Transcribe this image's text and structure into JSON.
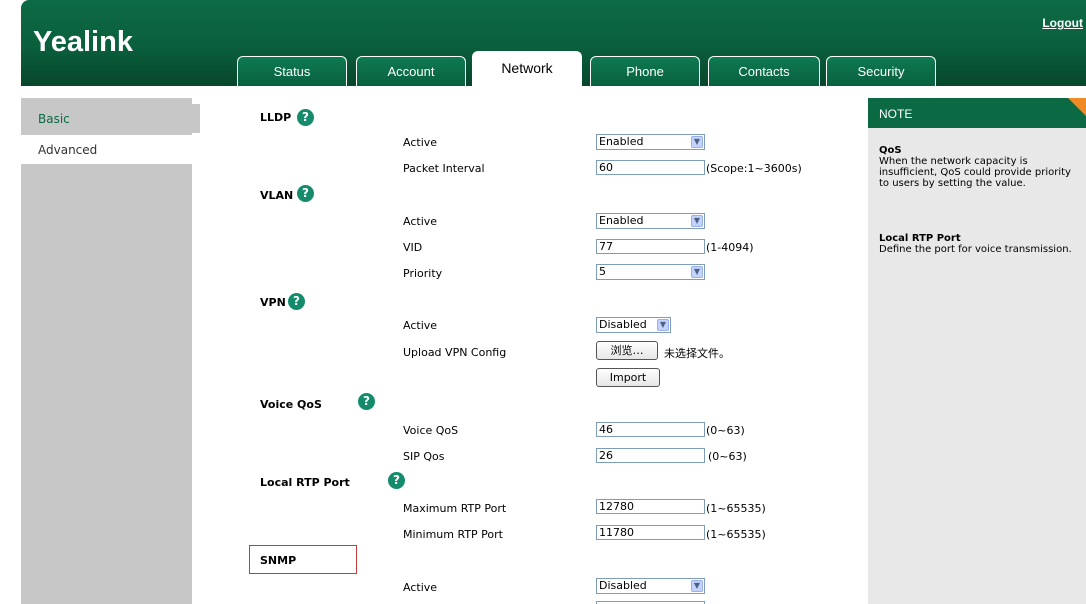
{
  "header": {
    "logo": "Yealink",
    "logout": "Logout"
  },
  "tabs": [
    {
      "label": "Status"
    },
    {
      "label": "Account"
    },
    {
      "label": "Network"
    },
    {
      "label": "Phone"
    },
    {
      "label": "Contacts"
    },
    {
      "label": "Security"
    }
  ],
  "active_tab": "Network",
  "sidebar": {
    "items": [
      {
        "label": "Basic"
      },
      {
        "label": "Advanced"
      }
    ],
    "selected": "Advanced"
  },
  "sections": {
    "lldp": {
      "title": "LLDP",
      "active_label": "Active",
      "active_value": "Enabled",
      "interval_label": "Packet Interval",
      "interval_value": "60",
      "interval_scope": "(Scope:1~3600s)"
    },
    "vlan": {
      "title": "VLAN",
      "active_label": "Active",
      "active_value": "Enabled",
      "vid_label": "VID",
      "vid_value": "77",
      "vid_scope": "(1-4094)",
      "priority_label": "Priority",
      "priority_value": "5"
    },
    "vpn": {
      "title": "VPN",
      "active_label": "Active",
      "active_value": "Disabled",
      "upload_label": "Upload VPN Config",
      "browse_button": "浏览…",
      "no_file_text": "未选择文件。",
      "import_button": "Import"
    },
    "voice_qos": {
      "title": "Voice QoS",
      "voice_label": "Voice QoS",
      "voice_value": "46",
      "voice_scope": "(0~63)",
      "sip_label": "SIP Qos",
      "sip_value": "26",
      "sip_scope": "(0~63)"
    },
    "rtp": {
      "title": "Local RTP Port",
      "max_label": "Maximum RTP Port",
      "max_value": "12780",
      "max_scope": "(1~65535)",
      "min_label": "Minimum RTP Port",
      "min_value": "11780",
      "min_scope": "(1~65535)"
    },
    "snmp": {
      "title": "SNMP",
      "active_label": "Active",
      "active_value": "Disabled"
    }
  },
  "note": {
    "header": "NOTE",
    "qos_title": "QoS",
    "qos_text": "When the network capacity is insufficient, QoS could provide priority to users by setting the value.",
    "rtp_title": "Local RTP Port",
    "rtp_text": "Define the port for voice transmission."
  },
  "colors": {
    "brand_green": "#0b6a44",
    "help_icon": "#148c6c",
    "highlight_box": "#c23b3b",
    "note_corner": "#f08a24"
  }
}
